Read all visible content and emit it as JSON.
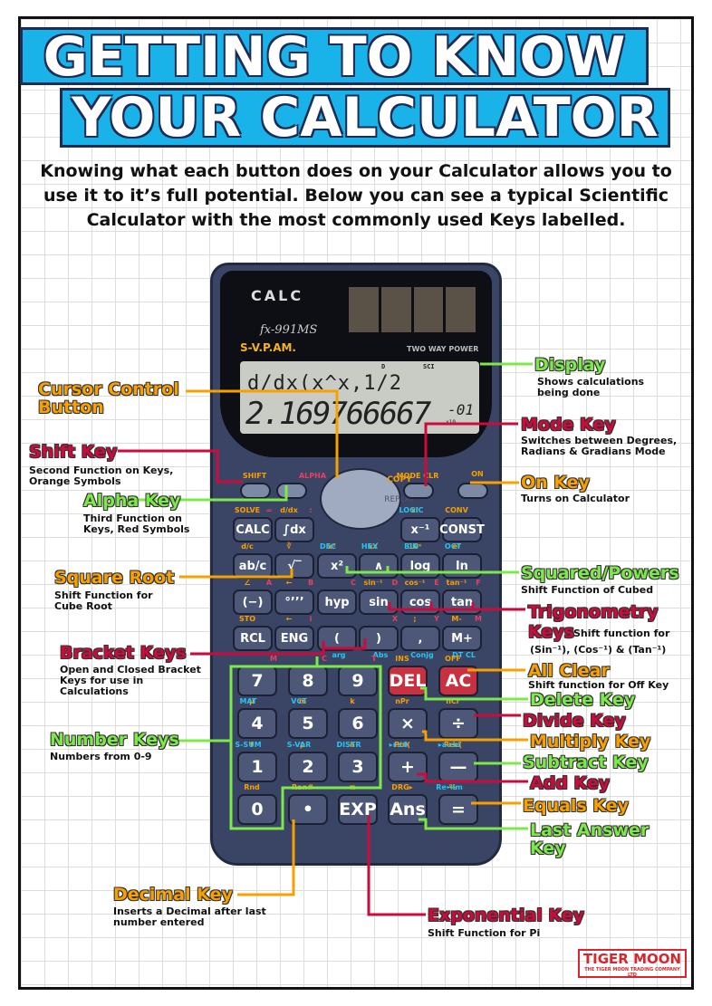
{
  "title": {
    "line1": "GETTING TO KNOW",
    "line2": "YOUR CALCULATOR"
  },
  "intro": "Knowing what each button does on your Calculator allows you to use it to it’s full potential. Below you can see a typical Scientific Calculator with the most commonly used Keys labelled.",
  "calculator": {
    "brand": "CALC",
    "model": "fx-991MS",
    "svpam": "S-V.P.AM.",
    "power": "TWO WAY POWER",
    "display": {
      "top": "d/dx(x^x,1/2",
      "bottom": "2.169766667",
      "exponent": "-01",
      "x10": "x10",
      "ind_d": "D",
      "ind_sci": "SCI"
    },
    "nav": {
      "copy": "COPY",
      "replay": "REPLAY"
    },
    "keys": [
      {
        "label": "",
        "shift": "SHIFT"
      },
      {
        "label": "",
        "alpha": "ALPHA"
      },
      {
        "label": "",
        "shift": "MODE CLR"
      },
      {
        "label": "",
        "top": "ON"
      },
      {
        "label": "CALC",
        "shift": "SOLVE",
        "alpha": "="
      },
      {
        "label": "∫dx",
        "shift": "d/dx",
        "alpha": ":"
      },
      {
        "label": "x⁻¹",
        "shift": "x!",
        "blue": "LOGIC"
      },
      {
        "label": "CONST",
        "shift": "CONV"
      },
      {
        "label": "ab/c",
        "shift": "d/c"
      },
      {
        "label": "√‾",
        "shift": "∛"
      },
      {
        "label": "x²",
        "shift": "x³",
        "blue": "DEC"
      },
      {
        "label": "∧",
        "shift": "x√",
        "blue": "HEX"
      },
      {
        "label": "log",
        "shift": "10ˣ",
        "blue": "BIN"
      },
      {
        "label": "ln",
        "shift": "eˣ",
        "blue": "OCT"
      },
      {
        "label": "(−)",
        "shift": "∠",
        "alpha": "A"
      },
      {
        "label": "°’’’",
        "shift": "←",
        "alpha": "B"
      },
      {
        "label": "hyp",
        "alpha": "C"
      },
      {
        "label": "sin",
        "shift": "sin⁻¹",
        "alpha": "D"
      },
      {
        "label": "cos",
        "shift": "cos⁻¹",
        "alpha": "E"
      },
      {
        "label": "tan",
        "shift": "tan⁻¹",
        "alpha": "F"
      },
      {
        "label": "RCL",
        "shift": "STO"
      },
      {
        "label": "ENG",
        "shift": "←",
        "alpha": "i"
      },
      {
        "label": "(",
        "below": "arg"
      },
      {
        "label": ")",
        "alpha": "X",
        "below": "Abs"
      },
      {
        "label": ",",
        "shift": ";",
        "alpha": "Y",
        "below": "Conjg"
      },
      {
        "label": "M+",
        "shift": "M-",
        "alpha": "M",
        "below": "DT CL"
      },
      {
        "label": "7",
        "alpha": "M"
      },
      {
        "label": "8",
        "alpha": "C"
      },
      {
        "label": "9",
        "alpha": "T"
      },
      {
        "label": "DEL",
        "shift": "INS"
      },
      {
        "label": "AC",
        "shift": "OFF"
      },
      {
        "label": "4",
        "blue": "MAT",
        "shift": "μ"
      },
      {
        "label": "5",
        "blue": "VCT",
        "shift": "m"
      },
      {
        "label": "6",
        "shift": "k"
      },
      {
        "label": "×",
        "shift": "nPr"
      },
      {
        "label": "÷",
        "shift": "nCr"
      },
      {
        "label": "1",
        "blue": "S-SUM",
        "shift": "f"
      },
      {
        "label": "2",
        "blue": "S-VAR",
        "shift": "p"
      },
      {
        "label": "3",
        "blue": "DISTR",
        "shift": "n"
      },
      {
        "label": "+",
        "blue": "▸r∠θ",
        "shift": "Pol("
      },
      {
        "label": "—",
        "blue": "▸a+bi",
        "shift": "Rec("
      },
      {
        "label": "0",
        "shift": "Rnd"
      },
      {
        "label": "•",
        "shift": "Ran#"
      },
      {
        "label": "EXP",
        "shift": "π"
      },
      {
        "label": "Ans",
        "shift": "DRG▸"
      },
      {
        "label": "=",
        "blue": "Re↔Im",
        "shift": "%"
      }
    ]
  },
  "callouts": {
    "display": {
      "title": "Display",
      "desc": "Shows calculations being done"
    },
    "cursor": {
      "title": "Cursor Control Button"
    },
    "mode": {
      "title": "Mode Key",
      "desc": "Switches between Degrees, Radians & Gradians Mode"
    },
    "shift": {
      "title": "Shift Key",
      "desc": "Second Function on Keys, Orange Symbols"
    },
    "on": {
      "title": "On Key",
      "desc": "Turns on Calculator"
    },
    "alpha": {
      "title": "Alpha Key",
      "desc": "Third Function on Keys, Red Symbols"
    },
    "sqrt": {
      "title": "Square Root",
      "desc": "Shift Function for Cube Root"
    },
    "squared": {
      "title": "Squared/Powers",
      "desc": "Shift Function of Cubed"
    },
    "trig": {
      "title": "Trigonometry",
      "title2": "Keys",
      "desc": "Shift function for",
      "desc2": "(Sin⁻¹), (Cos⁻¹) & (Tan⁻¹)"
    },
    "bracket": {
      "title": "Bracket Keys",
      "desc": "Open and Closed Bracket Keys for use in Calculations"
    },
    "allclear": {
      "title": "All Clear",
      "desc": "Shift function for Off Key"
    },
    "delete": {
      "title": "Delete Key"
    },
    "divide": {
      "title": "Divide Key"
    },
    "number": {
      "title": "Number Keys",
      "desc": "Numbers from 0-9"
    },
    "multiply": {
      "title": "Multiply Key"
    },
    "subtract": {
      "title": "Subtract Key"
    },
    "add": {
      "title": "Add Key"
    },
    "equals": {
      "title": "Equals Key"
    },
    "answer": {
      "title": "Last Answer Key"
    },
    "decimal": {
      "title": "Decimal Key",
      "desc": "Inserts a Decimal after last number entered"
    },
    "exponential": {
      "title": "Exponential Key",
      "desc": "Shift Function for Pi"
    }
  },
  "logo": {
    "name": "TIGER MOON",
    "tagline": "THE TIGER MOON TRADING COMPANY LTD"
  },
  "colors": {
    "green": "#7de84a",
    "red": "#cc0a3c",
    "orange": "#f7a000",
    "banner": "#19b3ea"
  }
}
